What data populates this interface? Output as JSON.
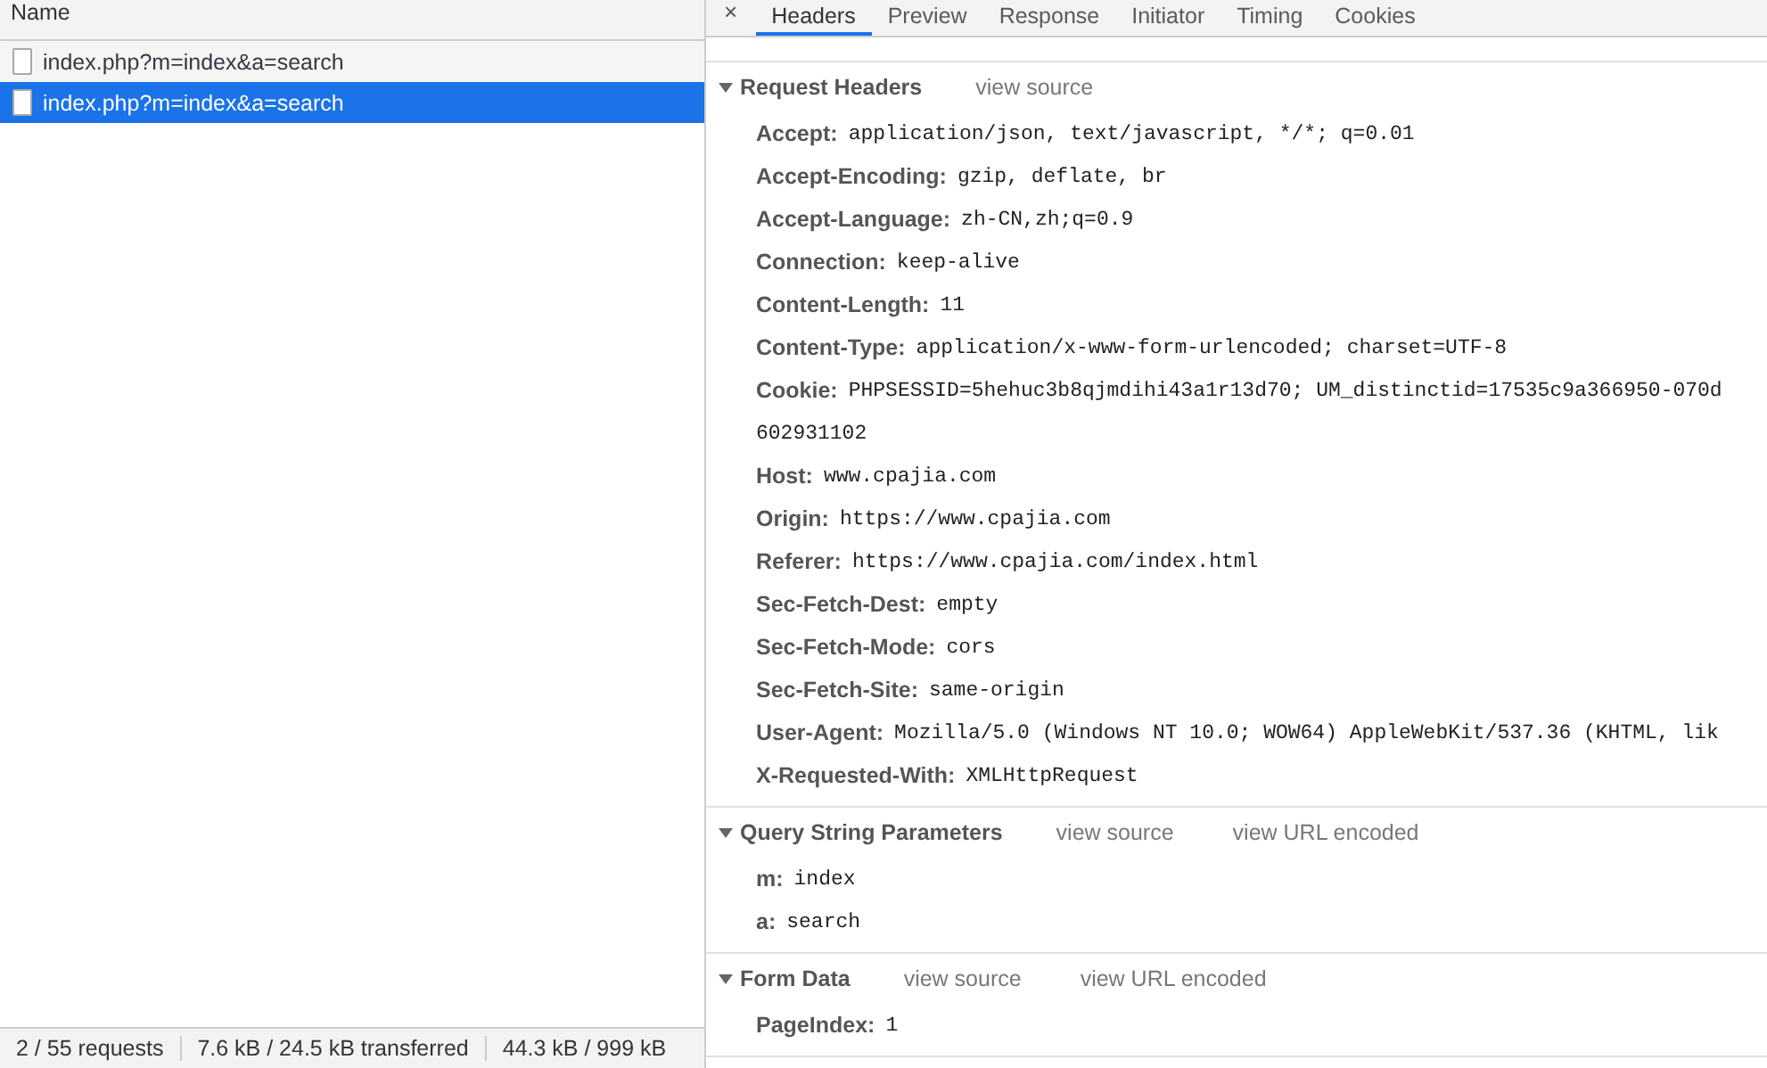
{
  "request_list": {
    "column_header": "Name",
    "requests": [
      {
        "name": "index.php?m=index&a=search",
        "selected": false
      },
      {
        "name": "index.php?m=index&a=search",
        "selected": true
      }
    ]
  },
  "status_bar": [
    "2 / 55 requests",
    "7.6 kB / 24.5 kB transferred",
    "44.3 kB / 999 kB"
  ],
  "detail_tabs": {
    "close": "×",
    "tabs": [
      {
        "label": "Headers",
        "selected": true
      },
      {
        "label": "Preview",
        "selected": false
      },
      {
        "label": "Response",
        "selected": false
      },
      {
        "label": "Initiator",
        "selected": false
      },
      {
        "label": "Timing",
        "selected": false
      },
      {
        "label": "Cookies",
        "selected": false
      }
    ]
  },
  "sections": [
    {
      "title": "Request Headers",
      "expanded": true,
      "links": [
        "view source"
      ],
      "rows": [
        {
          "name": "Accept:",
          "value_lines": [
            "application/json, text/javascript, */*; q=0.01"
          ]
        },
        {
          "name": "Accept-Encoding:",
          "value_lines": [
            "gzip, deflate, br"
          ]
        },
        {
          "name": "Accept-Language:",
          "value_lines": [
            "zh-CN,zh;q=0.9"
          ]
        },
        {
          "name": "Connection:",
          "value_lines": [
            "keep-alive"
          ]
        },
        {
          "name": "Content-Length:",
          "value_lines": [
            "11"
          ]
        },
        {
          "name": "Content-Type:",
          "value_lines": [
            "application/x-www-form-urlencoded; charset=UTF-8"
          ]
        },
        {
          "name": "Cookie:",
          "value_lines": [
            "PHPSESSID=5hehuc3b8qjmdihi43a1r13d70; UM_distinctid=17535c9a366950-070d",
            "602931102"
          ]
        },
        {
          "name": "Host:",
          "value_lines": [
            "www.cpajia.com"
          ]
        },
        {
          "name": "Origin:",
          "value_lines": [
            "https://www.cpajia.com"
          ]
        },
        {
          "name": "Referer:",
          "value_lines": [
            "https://www.cpajia.com/index.html"
          ]
        },
        {
          "name": "Sec-Fetch-Dest:",
          "value_lines": [
            "empty"
          ]
        },
        {
          "name": "Sec-Fetch-Mode:",
          "value_lines": [
            "cors"
          ]
        },
        {
          "name": "Sec-Fetch-Site:",
          "value_lines": [
            "same-origin"
          ]
        },
        {
          "name": "User-Agent:",
          "value_lines": [
            "Mozilla/5.0 (Windows NT 10.0; WOW64) AppleWebKit/537.36 (KHTML, lik"
          ]
        },
        {
          "name": "X-Requested-With:",
          "value_lines": [
            "XMLHttpRequest"
          ]
        }
      ]
    },
    {
      "title": "Query String Parameters",
      "expanded": true,
      "links": [
        "view source",
        "view URL encoded"
      ],
      "rows": [
        {
          "name": "m:",
          "value_lines": [
            "index"
          ]
        },
        {
          "name": "a:",
          "value_lines": [
            "search"
          ]
        }
      ]
    },
    {
      "title": "Form Data",
      "expanded": true,
      "links": [
        "view source",
        "view URL encoded"
      ],
      "rows": [
        {
          "name": "PageIndex:",
          "value_lines": [
            "1"
          ]
        }
      ]
    }
  ]
}
